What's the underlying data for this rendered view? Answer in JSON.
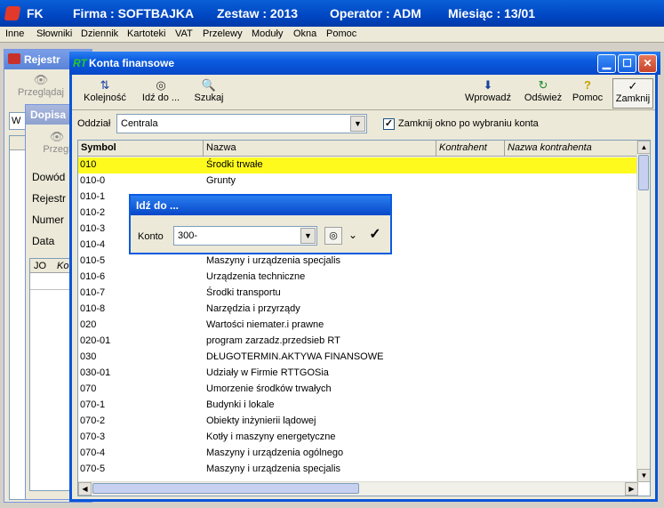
{
  "app": {
    "name": "FK",
    "firma": "Firma : SOFTBAJKA",
    "zestaw": "Zestaw : 2013",
    "operator": "Operator : ADM",
    "miesiac": "Miesiąc : 13/01"
  },
  "menu": [
    "Inne",
    "Słowniki",
    "Dziennik",
    "Kartoteki",
    "VAT",
    "Przelewy",
    "Moduły",
    "Okna",
    "Pomoc"
  ],
  "bg_windows": {
    "rejestr_title": "Rejestr",
    "rejestr_tool": "Przeglądaj",
    "rejestr_field": "W",
    "dopis_title": "Dopisa",
    "dopis_tool": "Przegl",
    "dopis_labels": [
      "Dowód",
      "Rejestr",
      "Numer",
      "Data"
    ],
    "dopis_cols": [
      "JO",
      "Ko"
    ]
  },
  "window": {
    "badge": "RT",
    "title": "Konta finansowe",
    "toolbar": {
      "kolejnosc": "Kolejność",
      "idz_do": "Idź do ...",
      "szukaj": "Szukaj",
      "wprowadz": "Wprowadź",
      "odswiez": "Odśwież",
      "pomoc": "Pomoc",
      "zamknij": "Zamknij"
    },
    "oddzial_label": "Oddział",
    "oddzial_value": "Centrala",
    "close_checkbox_label": "Zamknij okno po wybraniu konta",
    "columns": [
      "Symbol",
      "Nazwa",
      "Kontrahent",
      "Nazwa kontrahenta"
    ],
    "rows": [
      {
        "symbol": "010",
        "nazwa": "Środki trwałe"
      },
      {
        "symbol": "010-0",
        "nazwa": "Grunty"
      },
      {
        "symbol": "010-1",
        "nazwa": ""
      },
      {
        "symbol": "010-2",
        "nazwa": ""
      },
      {
        "symbol": "010-3",
        "nazwa": ""
      },
      {
        "symbol": "010-4",
        "nazwa": ""
      },
      {
        "symbol": "010-5",
        "nazwa": "Maszyny i urządzenia specjalis"
      },
      {
        "symbol": "010-6",
        "nazwa": "Urządzenia techniczne"
      },
      {
        "symbol": "010-7",
        "nazwa": "Środki transportu"
      },
      {
        "symbol": "010-8",
        "nazwa": "Narzędzia i przyrządy"
      },
      {
        "symbol": "020",
        "nazwa": "Wartości niemater.i prawne"
      },
      {
        "symbol": "020-01",
        "nazwa": "program zarzadz.przedsieb RT"
      },
      {
        "symbol": "030",
        "nazwa": "DŁUGOTERMIN.AKTYWA FINANSOWE"
      },
      {
        "symbol": "030-01",
        "nazwa": "Udziały  w Firmie RTTGOSia"
      },
      {
        "symbol": "070",
        "nazwa": "Umorzenie środków trwałych"
      },
      {
        "symbol": "070-1",
        "nazwa": "Budynki i lokale"
      },
      {
        "symbol": "070-2",
        "nazwa": "Obiekty inżynierii lądowej"
      },
      {
        "symbol": "070-3",
        "nazwa": "Kotły i maszyny energetyczne"
      },
      {
        "symbol": "070-4",
        "nazwa": "Maszyny i urządzenia ogólnego"
      },
      {
        "symbol": "070-5",
        "nazwa": "Maszyny i urządzenia specjalis"
      }
    ]
  },
  "dialog": {
    "title": "Idź do ...",
    "konto_label": "Konto",
    "konto_value": "300-"
  }
}
